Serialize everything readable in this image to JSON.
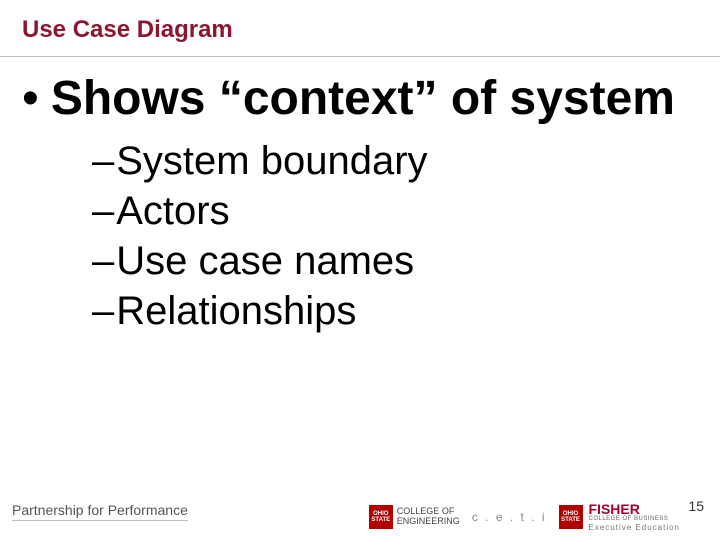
{
  "title": "Use Case Diagram",
  "bullet": {
    "dot": "•",
    "text": "Shows “context” of system"
  },
  "sub": {
    "dash": "–",
    "items": [
      "System boundary",
      "Actors",
      "Use case names",
      "Relationships"
    ]
  },
  "footer": {
    "partnership": "Partnership for Performance",
    "slide_number": "15"
  },
  "logos": {
    "osu_line1": "OHIO",
    "osu_line2": "STATE",
    "engineering_line1": "COLLEGE OF",
    "engineering_line2": "ENGINEERING",
    "ceti": "c . e . t . i",
    "fisher_main": "FISHER",
    "fisher_sub1": "COLLEGE OF BUSINESS",
    "fisher_sub2": "Executive Education"
  }
}
